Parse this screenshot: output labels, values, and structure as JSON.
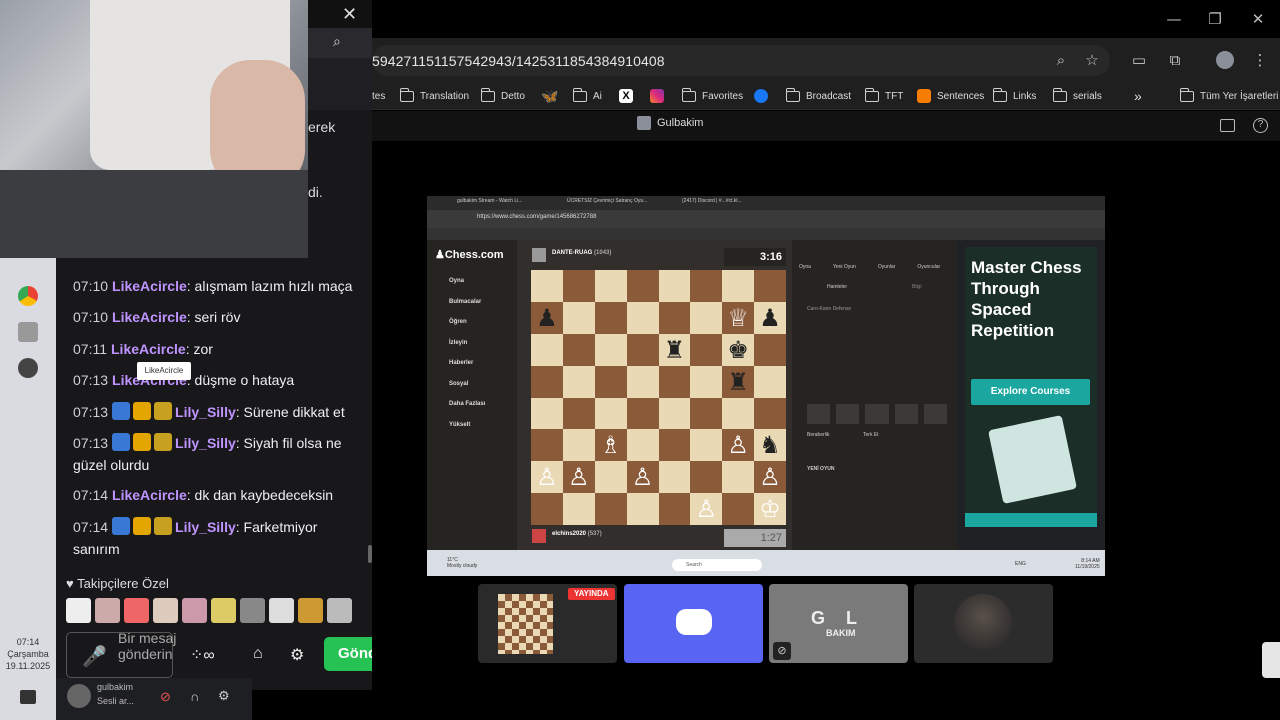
{
  "browser": {
    "url": "5942711511575429 43/1425311854384910408",
    "url_text": "59427115115754294 3/1425311854384910408",
    "address": "594271151157542943/1425311854384910408",
    "bookmarks": [
      {
        "label": "tes",
        "kind": "text"
      },
      {
        "label": "Translation",
        "kind": "folder"
      },
      {
        "label": "Detto",
        "kind": "folder"
      },
      {
        "label": "",
        "kind": "bluesky"
      },
      {
        "label": "Ai",
        "kind": "folder"
      },
      {
        "label": "",
        "kind": "x"
      },
      {
        "label": "",
        "kind": "instagram"
      },
      {
        "label": "Favorites",
        "kind": "folder"
      },
      {
        "label": "",
        "kind": "facebook"
      },
      {
        "label": "Broadcast",
        "kind": "folder"
      },
      {
        "label": "TFT",
        "kind": "folder"
      },
      {
        "label": "Sentences",
        "kind": "blogger"
      },
      {
        "label": "Links",
        "kind": "folder"
      },
      {
        "label": "serials",
        "kind": "folder"
      }
    ],
    "more_bookmarks": "»",
    "all_bookmarks": "Tüm Yer İşaretleri",
    "page_title": "Gulbakim"
  },
  "chat": {
    "partial_top": "erek",
    "partial_2": "di.",
    "partial_3": "",
    "messages": [
      {
        "time": "07:10",
        "user": "LikeAcircle",
        "text": "alışmam lazım hızlı maça",
        "badges": false
      },
      {
        "time": "07:10",
        "user": "LikeAcircle",
        "text": "seri röv",
        "badges": false
      },
      {
        "time": "07:11",
        "user": "LikeAcircle",
        "text": "zor",
        "badges": false
      },
      {
        "time": "07:13",
        "user": "LikeAcircle",
        "text": "düşme o hataya",
        "badges": false
      },
      {
        "time": "07:13",
        "user": "Lily_Silly",
        "text": "Sürene dikkat et",
        "badges": true
      },
      {
        "time": "07:13",
        "user": "Lily_Silly",
        "text": "Siyah fil olsa ne güzel olurdu",
        "badges": true
      },
      {
        "time": "07:14",
        "user": "LikeAcircle",
        "text": "dk dan kaybedeceksin",
        "badges": false
      },
      {
        "time": "07:14",
        "user": "Lily_Silly",
        "text": "Farketmiyor sanırım",
        "badges": true
      }
    ],
    "tooltip": "LikeAcircle",
    "followers_label": "Takipçilere Özel",
    "input_placeholder": "Bir mesaj gönderin",
    "send_label": "Gönder",
    "voice_name": "gulbakim",
    "voice_status": "Sesli ar..."
  },
  "taskbar": {
    "time": "07:14",
    "day": "Çarşamba",
    "date": "19.11.2025"
  },
  "stream": {
    "tabs": [
      "gulbakim Stream - Watch Li...",
      "ÜCRETSİZ Çevrimiçi Satranç Oyu...",
      "(2417) Discord | #...#ct.kl..."
    ],
    "url": "https://www.chess.com/game/145686272788",
    "nav": [
      "Oyna",
      "Bulmacalar",
      "Öğren",
      "İzleyin",
      "Haberler",
      "Sosyal",
      "Daha Fazlası",
      "Yükselt"
    ],
    "opponent": "DANTE-RUAG",
    "opponent_rating": "(1043)",
    "opponent_clock": "3:16",
    "player": "elchins2020",
    "player_rating": "(537)",
    "player_clock": "1:27",
    "panel_tabs": [
      "Oyna",
      "Yeni Oyun",
      "Oyunlar",
      "Oyuncular"
    ],
    "moves_tab": "Hamleler",
    "info_tab": "Bilgi",
    "opening": "Caro-Kann Defense",
    "draw": "Beraberlik",
    "resign": "Terk Et",
    "new_game": "YENİ OYUN",
    "ad_title": "Master Chess Through Spaced Repetition",
    "ad_button": "Explore Courses",
    "weather": "11°C",
    "weather_desc": "Mostly cloudy",
    "search": "Search",
    "lang": "ENG",
    "st_time": "8:14 AM",
    "st_date": "11/19/2025"
  },
  "thumbs": {
    "live_badge": "YAYINDA",
    "gol_text": "G L",
    "bakim_text": "BAKIM"
  }
}
